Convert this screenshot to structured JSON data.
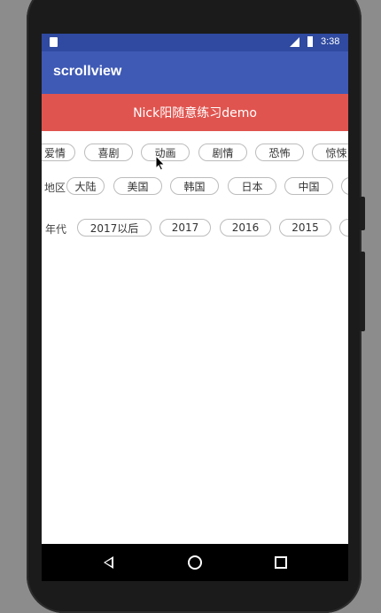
{
  "status_bar": {
    "time": "3:38"
  },
  "app_bar": {
    "title": "scrollview"
  },
  "banner": {
    "text": "Nick阳随意练习demo"
  },
  "rows": [
    {
      "label": "",
      "chips": [
        "爱情",
        "喜剧",
        "动画",
        "剧情",
        "恐怖",
        "惊悚"
      ]
    },
    {
      "label": "地区",
      "chips": [
        "大陆",
        "美国",
        "韩国",
        "日本",
        "中国",
        ""
      ]
    },
    {
      "label": "年代",
      "chips": [
        "2017以后",
        "2017",
        "2016",
        "2015",
        ""
      ]
    }
  ],
  "colors": {
    "status_bar": "#2f4aa0",
    "app_bar": "#3f5ab5",
    "banner": "#e0544f"
  },
  "nav": {
    "icons": [
      "back-icon",
      "home-icon",
      "recents-icon"
    ]
  }
}
